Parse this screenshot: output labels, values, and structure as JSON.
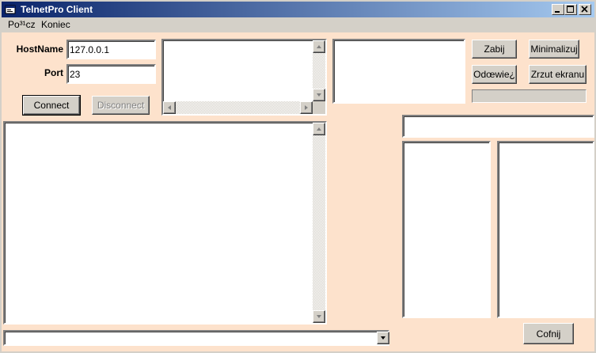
{
  "window": {
    "title": "TelnetPro Client",
    "controls": [
      "minimize-icon",
      "maximize-icon",
      "close-icon"
    ]
  },
  "menu": {
    "items": [
      {
        "label": "Po³¹cz",
        "underline": "P"
      },
      {
        "label": "Koniec",
        "underline": "K"
      }
    ]
  },
  "connection": {
    "hostname_label": "HostName",
    "hostname_value": "127.0.0.1",
    "port_label": "Port",
    "port_value": "23",
    "connect_label": "Connect",
    "disconnect_label": "Disconnect"
  },
  "toolbar": {
    "kill_label": "Zabij",
    "minimize_label": "Minimalizuj",
    "refresh_label": "Odœwie¿",
    "screenshot_label": "Zrzut ekranu",
    "back_label": "Cofnij"
  },
  "progress": {
    "value": 0
  },
  "command": {
    "value": ""
  },
  "path": {
    "value": ""
  },
  "colors": {
    "client_bg": "#fde2cc",
    "face": "#d4d0c8",
    "title_start": "#0a246a",
    "title_end": "#a6caf0"
  }
}
